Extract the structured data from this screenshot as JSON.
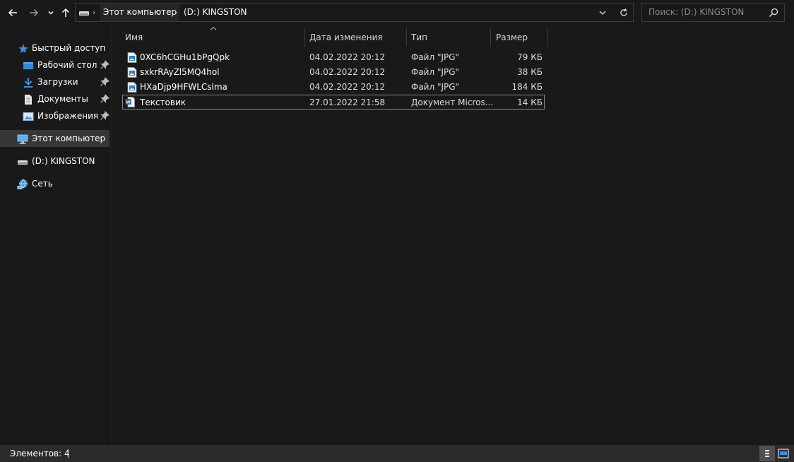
{
  "address": {
    "path": [
      "Этот компьютер",
      "(D:) KINGSTON"
    ]
  },
  "search": {
    "placeholder": "Поиск: (D:) KINGSTON"
  },
  "sidebar": {
    "items": [
      {
        "label": "Быстрый доступ",
        "icon": "star-icon"
      },
      {
        "label": "Рабочий стол",
        "icon": "desktop-folder-icon",
        "pinned": true
      },
      {
        "label": "Загрузки",
        "icon": "downloads-icon",
        "pinned": true
      },
      {
        "label": "Документы",
        "icon": "documents-icon",
        "pinned": true
      },
      {
        "label": "Изображения",
        "icon": "pictures-icon",
        "pinned": true
      },
      {
        "label": "Этот компьютер",
        "icon": "computer-icon",
        "selected": true
      },
      {
        "label": "(D:) KINGSTON",
        "icon": "drive-icon"
      },
      {
        "label": "Сеть",
        "icon": "network-icon"
      }
    ]
  },
  "columns": {
    "name": "Имя",
    "date": "Дата изменения",
    "type": "Тип",
    "size": "Размер"
  },
  "files": [
    {
      "name": "0XC6hCGHu1bPgQpk",
      "date": "04.02.2022 20:12",
      "type": "Файл \"JPG\"",
      "size": "79 КБ",
      "icon": "jpg-file-icon"
    },
    {
      "name": "sxkrRAyZl5MQ4hol",
      "date": "04.02.2022 20:12",
      "type": "Файл \"JPG\"",
      "size": "38 КБ",
      "icon": "jpg-file-icon"
    },
    {
      "name": "HXaDjp9HFWLCslma",
      "date": "04.02.2022 20:12",
      "type": "Файл \"JPG\"",
      "size": "184 КБ",
      "icon": "jpg-file-icon"
    },
    {
      "name": "Текстовик",
      "date": "27.01.2022 21:58",
      "type": "Документ Micros...",
      "size": "14 КБ",
      "icon": "word-document-icon"
    }
  ],
  "status": {
    "items_text": "Элементов: 4"
  },
  "colors": {
    "background": "#191919",
    "statusbar": "#2b2b2b",
    "selection": "#373737",
    "accent_blue": "#3b8de3"
  }
}
